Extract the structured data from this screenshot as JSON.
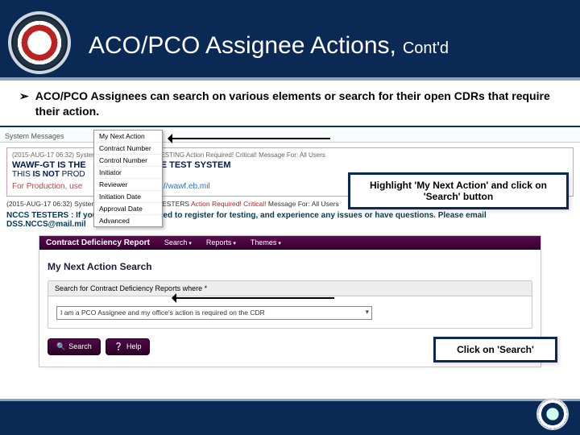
{
  "header": {
    "title": "ACO/PCO Assignee Actions,",
    "subtitle": "Cont'd"
  },
  "bullet": {
    "marker": "➢",
    "text": "ACO/PCO Assignees can search on various elements or search for their open CDRs that require their action."
  },
  "dropdown": {
    "items": [
      "My Next Action",
      "Contract Number",
      "Control Number",
      "Initiator",
      "Reviewer",
      "Initiation Date",
      "Approval Date",
      "Advanced"
    ]
  },
  "sys_bar": "System Messages",
  "msg": {
    "meta": "(2015-AUG-17 06:32) System: All  Subject: WAWF-TESTING Action Required! Critical! Message For: All Users",
    "l1": "WAWF-GT IS THE",
    "l1b": "E TEST SYSTEM",
    "l2a": "THIS ",
    "l2b": "IS NOT",
    "l2c": " PROD",
    "l3a": "For Production, use",
    "l3link_pre": "nk ",
    "l3link": "https://wawf.eb.mil"
  },
  "line2": {
    "pre": "(2015-AUG-17 06:32) System: All  Subject: NCCS TESTERS ",
    "red": "Action Required! Critical!",
    "post": " Message For: All Users"
  },
  "line3": {
    "a": "NCCS TESTERS : If you have been directed to register for testing, and experience any issues or have questions. Please email",
    "b": "DSS.NCCS@mail.mil"
  },
  "cdr": {
    "title": "Contract Deficiency Report",
    "menus": [
      "Search",
      "Reports",
      "Themes"
    ],
    "heading": "My Next Action Search",
    "panelHead": "Search for Contract Deficiency Reports where *",
    "selectText": "I am a PCO Assignee and my office's action is required on the CDR",
    "searchBtn": "Search",
    "helpBtn": "Help"
  },
  "callout1": "Highlight 'My Next Action' and click on 'Search' button",
  "callout2": "Click on 'Search'"
}
